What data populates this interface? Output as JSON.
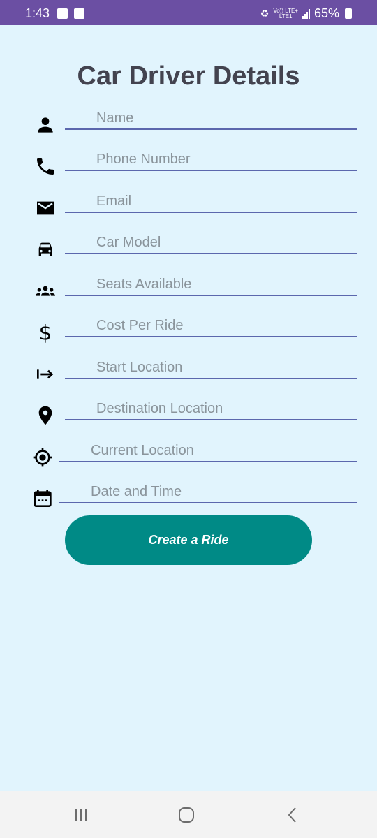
{
  "status_bar": {
    "time": "1:43",
    "network_label": "Vo)) LTE+",
    "network_sub": "LTE1",
    "battery": "65%"
  },
  "form": {
    "title": "Car Driver Details",
    "fields": [
      {
        "icon": "person-icon",
        "placeholder": "Name"
      },
      {
        "icon": "phone-icon",
        "placeholder": "Phone Number"
      },
      {
        "icon": "email-icon",
        "placeholder": "Email"
      },
      {
        "icon": "car-icon",
        "placeholder": "Car Model"
      },
      {
        "icon": "group-icon",
        "placeholder": "Seats Available"
      },
      {
        "icon": "dollar-icon",
        "placeholder": "Cost Per Ride"
      },
      {
        "icon": "arrow-right-icon",
        "placeholder": "Start Location"
      },
      {
        "icon": "location-pin-icon",
        "placeholder": "Destination Location"
      },
      {
        "icon": "gps-target-icon",
        "placeholder": "Current Location"
      },
      {
        "icon": "calendar-icon",
        "placeholder": "Date and Time"
      }
    ],
    "submit_label": "Create a Ride"
  },
  "colors": {
    "background": "#e1f4fd",
    "status_bar": "#6b4fa3",
    "accent_button": "#008a86",
    "underline": "#5b67ad"
  }
}
